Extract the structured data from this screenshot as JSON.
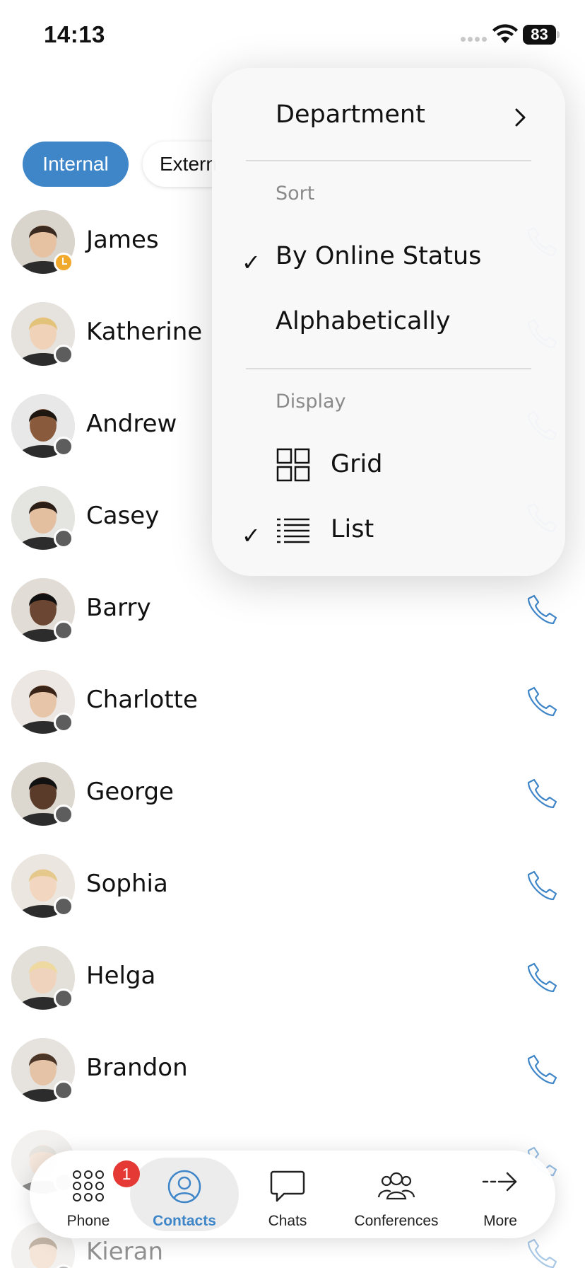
{
  "status_bar": {
    "time": "14:13",
    "battery": "83"
  },
  "filters": {
    "internal": "Internal",
    "external": "Extern"
  },
  "contacts": [
    {
      "name": "James",
      "status": "away"
    },
    {
      "name": "Katherine",
      "status": "offline"
    },
    {
      "name": "Andrew",
      "status": "offline"
    },
    {
      "name": "Casey",
      "status": "offline"
    },
    {
      "name": "Barry",
      "status": "offline"
    },
    {
      "name": "Charlotte",
      "status": "offline"
    },
    {
      "name": "George",
      "status": "offline"
    },
    {
      "name": "Sophia",
      "status": "offline"
    },
    {
      "name": "Helga",
      "status": "offline"
    },
    {
      "name": "Brandon",
      "status": "offline"
    },
    {
      "name": "",
      "status": "offline"
    },
    {
      "name": "Kieran",
      "status": "offline"
    }
  ],
  "menu": {
    "department": "Department",
    "sort_label": "Sort",
    "sort_options": [
      {
        "label": "By Online Status",
        "checked": true
      },
      {
        "label": "Alphabetically",
        "checked": false
      }
    ],
    "display_label": "Display",
    "display_options": [
      {
        "label": "Grid",
        "icon": "grid-icon",
        "checked": false
      },
      {
        "label": "List",
        "icon": "list-icon",
        "checked": true
      }
    ]
  },
  "tabbar": {
    "phone": "Phone",
    "phone_badge": "1",
    "contacts": "Contacts",
    "chats": "Chats",
    "conferences": "Conferences",
    "more": "More"
  },
  "colors": {
    "accent": "#3f86c9",
    "away": "#f0a92c",
    "offline": "#5d5d5d",
    "badge": "#e53935"
  }
}
